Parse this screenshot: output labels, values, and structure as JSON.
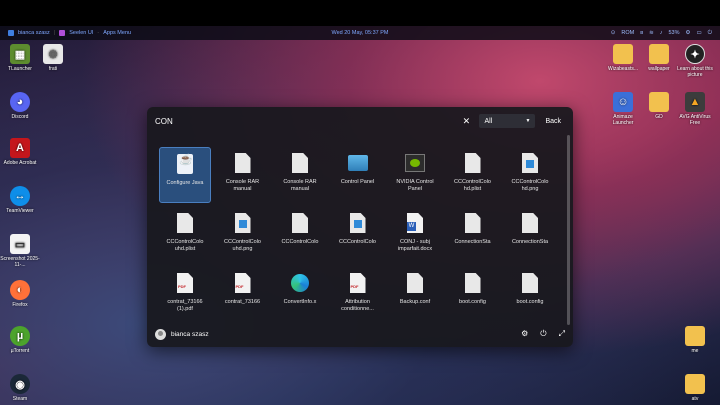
{
  "taskbar": {
    "user": "bianca szasz",
    "app1": "Seelen UI",
    "app2": "Apps Menu",
    "datetime": "Wed 20 May, 05:37 PM",
    "lang": "ROM",
    "battery": "53%"
  },
  "desktop_left": [
    {
      "label": "TLauncher",
      "icon": "tlauncher-icon"
    },
    {
      "label": "Discord",
      "icon": "discord-icon"
    },
    {
      "label": "Adobe Acrobat",
      "icon": "acrobat-icon"
    },
    {
      "label": "TeamViewer",
      "icon": "teamviewer-icon"
    },
    {
      "label": "Screenshot 2025-11-...",
      "icon": "screenshot-icon"
    },
    {
      "label": "Firefox",
      "icon": "firefox-icon"
    },
    {
      "label": "µTorrent",
      "icon": "utorrent-icon"
    },
    {
      "label": "Steam",
      "icon": "steam-icon"
    }
  ],
  "desktop_left2": [
    {
      "label": "frati",
      "icon": "frati-icon"
    }
  ],
  "desktop_right": [
    {
      "label": "Wizabeasts...",
      "icon": "folder-icon"
    },
    {
      "label": "wallpaper",
      "icon": "folder-icon"
    },
    {
      "label": "Learn about this picture",
      "icon": "learn-icon"
    },
    {
      "label": "Animaze Launcher",
      "icon": "animaze-icon"
    },
    {
      "label": "GD",
      "icon": "folder-icon"
    },
    {
      "label": "AVG AntiVirus Free",
      "icon": "avg-icon"
    },
    {
      "label": "me",
      "icon": "folder-icon"
    },
    {
      "label": "atv",
      "icon": "folder-icon"
    }
  ],
  "launcher": {
    "search_value": "CON",
    "filter": "All",
    "back_label": "Back",
    "user_name": "bianca szasz",
    "results": [
      {
        "label": "Configure Java",
        "type": "java",
        "selected": true
      },
      {
        "label": "Console RAR manual",
        "type": "doc"
      },
      {
        "label": "Console RAR manual",
        "type": "doc"
      },
      {
        "label": "Control Panel",
        "type": "cpanel"
      },
      {
        "label": "NVIDIA Control Panel",
        "type": "nvidia"
      },
      {
        "label": "CCControlColo hd.plist",
        "type": "doc"
      },
      {
        "label": "CCControlColo hd.png",
        "type": "img"
      },
      {
        "label": "CCControlColo uhd.plist",
        "type": "doc"
      },
      {
        "label": "CCControlColo uhd.png",
        "type": "img"
      },
      {
        "label": "CCControlColo",
        "type": "doc"
      },
      {
        "label": "CCControlColo",
        "type": "img"
      },
      {
        "label": "CONJ - subj imparfait.docx",
        "type": "word"
      },
      {
        "label": "ConnectionSta",
        "type": "doc"
      },
      {
        "label": "ConnectionSta",
        "type": "doc"
      },
      {
        "label": "contrat_73166 (1).pdf",
        "type": "pdf"
      },
      {
        "label": "contrat_73166",
        "type": "pdf"
      },
      {
        "label": "ConvertInfo.x",
        "type": "edge"
      },
      {
        "label": "Attribution conditionne...",
        "type": "pdf"
      },
      {
        "label": "Backup.conf",
        "type": "doc"
      },
      {
        "label": "boot.config",
        "type": "doc"
      },
      {
        "label": "boot.config",
        "type": "doc"
      }
    ]
  }
}
